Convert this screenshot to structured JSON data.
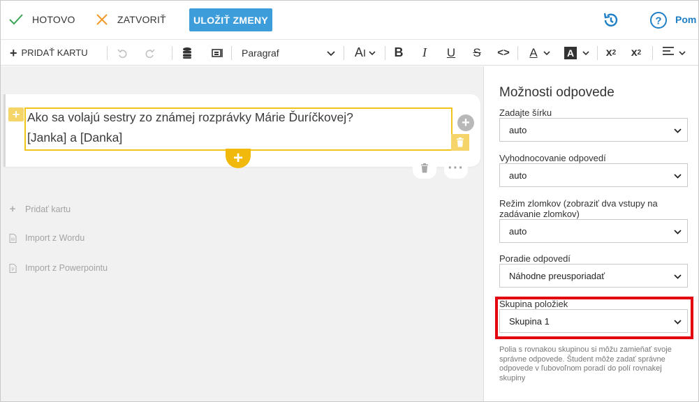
{
  "topbar": {
    "done_label": "HOTOVO",
    "close_label": "ZATVORIŤ",
    "save_label": "ULOŽIŤ ZMENY",
    "help_label": "Pom"
  },
  "toolbar": {
    "add_card_label": "PRIDAŤ KARTU",
    "paragraph_value": "Paragraf"
  },
  "editor": {
    "question": "Ako sa volajú sestry zo známej rozprávky Márie Ďuríčkovej?",
    "answer_line": "[Janka] a [Danka]"
  },
  "sidebar": {
    "items": [
      {
        "label": "Pridať kartu",
        "icon": "plus-icon"
      },
      {
        "label": "Import z Wordu",
        "icon": "word-doc-icon"
      },
      {
        "label": "Import z Powerpointu",
        "icon": "ppt-doc-icon"
      }
    ]
  },
  "panel": {
    "title": "Možnosti odpovede",
    "fields": [
      {
        "label": "Zadajte šírku",
        "value": "auto"
      },
      {
        "label": "Vyhodnocovanie odpovedí",
        "value": "auto"
      },
      {
        "label": "Režim zlomkov (zobraziť dva vstupy na zadávanie zlomkov)",
        "value": "auto"
      },
      {
        "label": "Poradie odpovedí",
        "value": "Náhodne preusporiadať"
      },
      {
        "label": "Skupina položiek",
        "value": "Skupina 1"
      }
    ],
    "hint": "Polia s rovnakou skupinou si môžu zamieňať svoje správne odpovede. Študent môže zadať správne odpovede v ľubovoľnom poradí do polí rovnakej skupiny"
  },
  "colors": {
    "accent_blue": "#3d9ddb",
    "check_green": "#3aa655",
    "close_orange": "#f39a2b",
    "editor_yellow": "#f0c419",
    "highlight_red": "#e3000f"
  }
}
